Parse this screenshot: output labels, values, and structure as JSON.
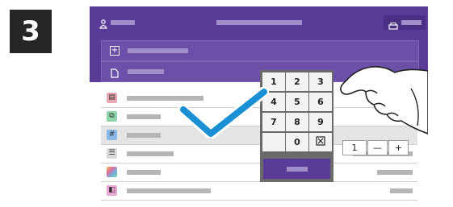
{
  "step": {
    "number": "3"
  },
  "keypad": {
    "keys": [
      "1",
      "2",
      "3",
      "4",
      "5",
      "6",
      "7",
      "8",
      "9",
      "0"
    ]
  },
  "quantity": {
    "value": "1",
    "minus": "—",
    "plus": "+"
  },
  "colors": {
    "brand_purple": "#5a3c98",
    "check_blue": "#1a8fd4",
    "badge_dark": "#262626"
  },
  "icons": [
    "user-icon",
    "printer-icon",
    "plus-square-icon",
    "document-icon",
    "check-icon",
    "backspace-icon",
    "hand-pointer-icon"
  ]
}
